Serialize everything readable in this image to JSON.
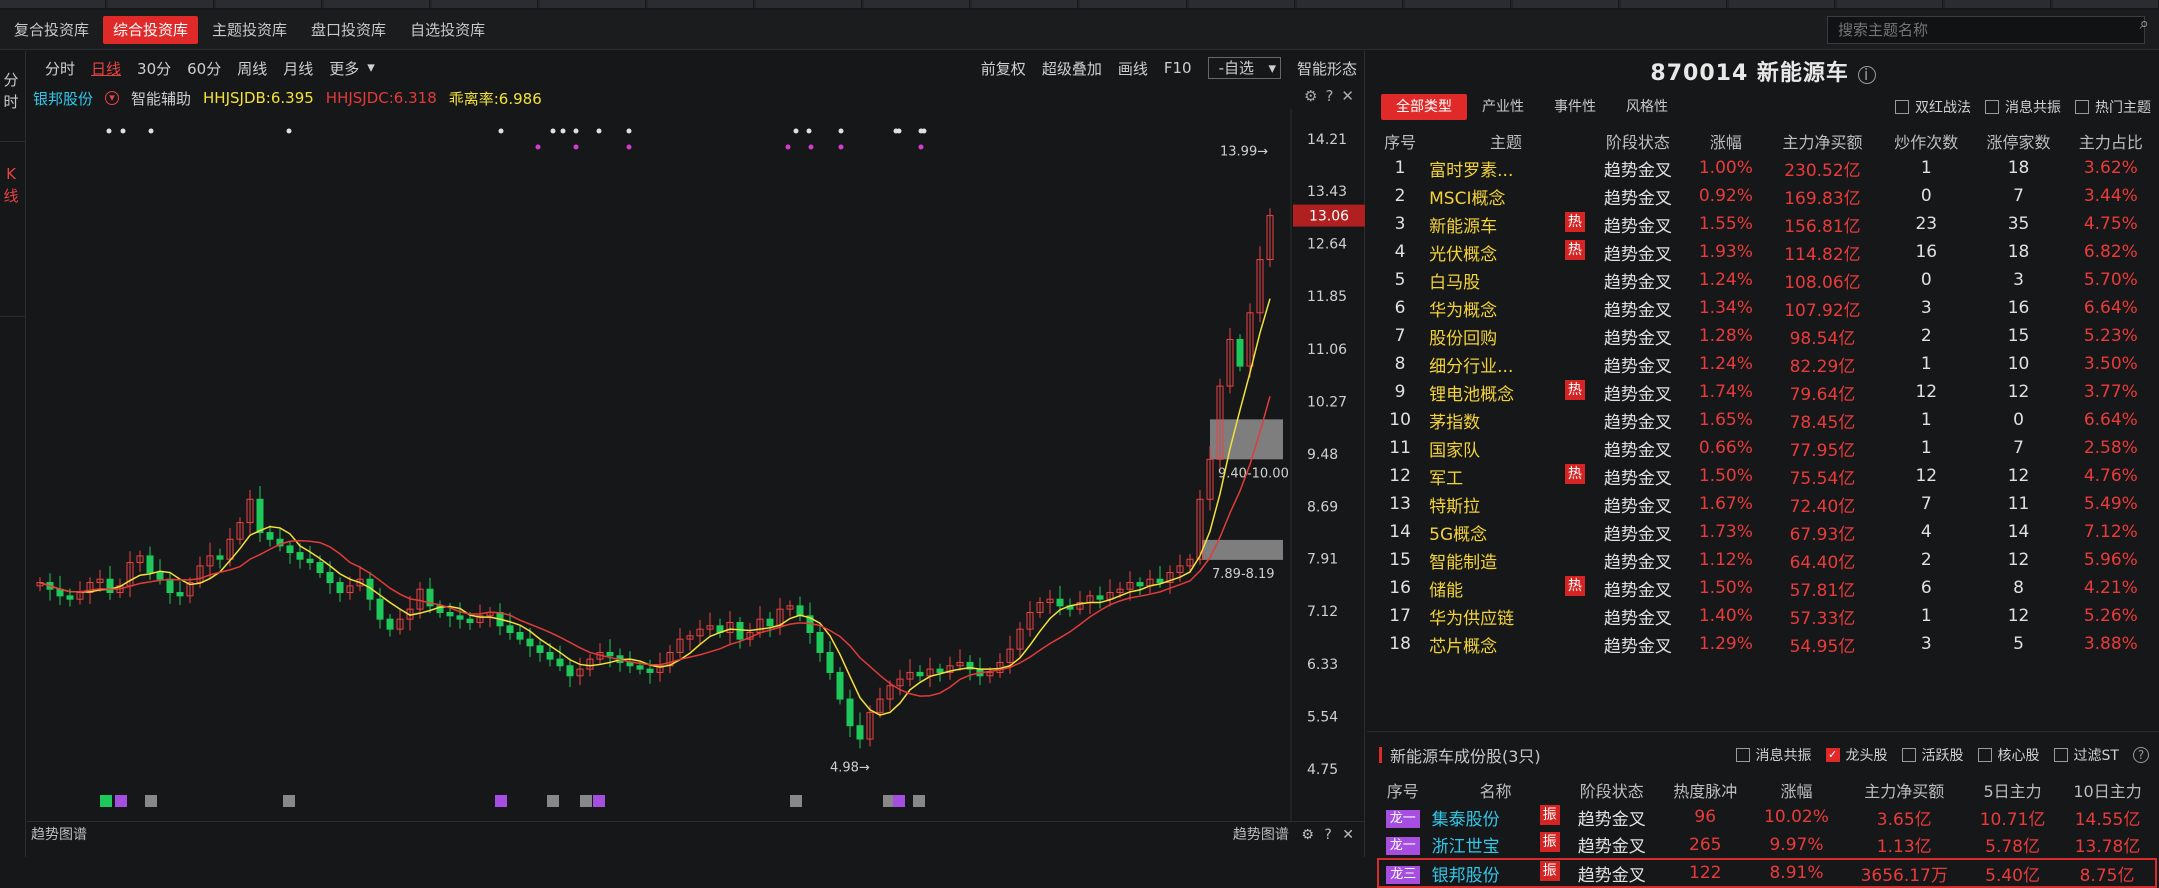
{
  "subnav": {
    "tabs": [
      "复合投资库",
      "综合投资库",
      "主题投资库",
      "盘口投资库",
      "自选投资库"
    ],
    "active_index": 1,
    "search_placeholder": "搜索主题名称"
  },
  "left_rail": {
    "tab_fenshi": "分时",
    "tab_kline": "K线"
  },
  "chart_toolbar": {
    "periods": [
      "分时",
      "日线",
      "30分",
      "60分",
      "周线",
      "月线",
      "更多"
    ],
    "active_period": 1,
    "right_items": [
      "前复权",
      "超级叠加",
      "画线",
      "F10",
      "智能形态"
    ],
    "zixuan_label": "-自选"
  },
  "indicator_bar": {
    "stock": "银邦股份",
    "assist": "智能辅助",
    "db": "HHJSJDB:6.395",
    "dc": "HHJSJDC:6.318",
    "ratio": "乖离率:6.986"
  },
  "chart_data": {
    "type": "candlestick",
    "y_ticks": [
      "14.21",
      "13.43",
      "12.64",
      "11.85",
      "11.06",
      "10.27",
      "9.48",
      "8.69",
      "7.91",
      "7.12",
      "6.33",
      "5.54",
      "4.75"
    ],
    "ylim": [
      4.75,
      14.21
    ],
    "current_price": "13.06",
    "high_label": "13.99",
    "low_label": "4.98",
    "zone_upper_label": "9.40-10.00",
    "zone_lower_label": "7.89-8.19",
    "zone_upper": [
      9.4,
      10.0
    ],
    "zone_lower": [
      7.89,
      8.19
    ],
    "closes": [
      7.55,
      7.45,
      7.35,
      7.3,
      7.4,
      7.55,
      7.6,
      7.4,
      7.5,
      7.85,
      7.95,
      7.7,
      7.6,
      7.4,
      7.35,
      7.55,
      7.8,
      7.95,
      7.9,
      8.2,
      8.45,
      8.8,
      8.3,
      8.2,
      8.1,
      8.0,
      7.9,
      7.85,
      7.7,
      7.55,
      7.4,
      7.5,
      7.6,
      7.3,
      7.0,
      6.85,
      7.0,
      7.15,
      7.45,
      7.2,
      7.1,
      7.05,
      7.0,
      6.95,
      7.05,
      7.1,
      6.9,
      6.8,
      6.7,
      6.6,
      6.5,
      6.4,
      6.3,
      6.15,
      6.25,
      6.4,
      6.5,
      6.45,
      6.35,
      6.3,
      6.25,
      6.2,
      6.3,
      6.5,
      6.7,
      6.75,
      6.85,
      6.9,
      6.8,
      6.95,
      6.7,
      6.8,
      7.0,
      6.9,
      7.15,
      7.2,
      7.05,
      6.8,
      6.5,
      6.2,
      5.8,
      5.4,
      5.2,
      5.6,
      5.8,
      6.0,
      6.1,
      6.2,
      6.15,
      6.25,
      6.2,
      6.3,
      6.35,
      6.25,
      6.15,
      6.2,
      6.35,
      6.55,
      6.85,
      7.1,
      7.25,
      7.3,
      7.2,
      7.15,
      7.25,
      7.35,
      7.3,
      7.4,
      7.45,
      7.55,
      7.5,
      7.6,
      7.55,
      7.7,
      7.8,
      7.9,
      8.8,
      9.4,
      10.5,
      11.2,
      10.8,
      11.6,
      12.4,
      13.06
    ]
  },
  "markers": {
    "top_white_dots": 12,
    "bottom_tags": [
      "减",
      "量",
      "日",
      "日",
      "量",
      "量",
      "日",
      "日",
      "量",
      "量",
      "減",
      "量"
    ]
  },
  "trend_panel": {
    "label": "趋势图谱",
    "right_label": "趋势图谱"
  },
  "right": {
    "title": "870014 新能源车",
    "filter_tabs": [
      "全部类型",
      "产业性",
      "事件性",
      "风格性"
    ],
    "active_filter": 0,
    "checks": [
      "双红战法",
      "消息共振",
      "热门主题"
    ],
    "table_headers": [
      "序号",
      "主题",
      "阶段状态",
      "涨幅",
      "主力净买额",
      "炒作次数",
      "涨停家数",
      "主力占比"
    ],
    "rows": [
      {
        "idx": "1",
        "name": "富时罗素...",
        "hot": "",
        "stage": "趋势金叉",
        "pct": "1.00%",
        "net": "230.52亿",
        "times": "1",
        "limit": "18",
        "ratio": "3.62%"
      },
      {
        "idx": "2",
        "name": "MSCI概念",
        "hot": "",
        "stage": "趋势金叉",
        "pct": "0.92%",
        "net": "169.83亿",
        "times": "0",
        "limit": "7",
        "ratio": "3.44%"
      },
      {
        "idx": "3",
        "name": "新能源车",
        "hot": "热",
        "stage": "趋势金叉",
        "pct": "1.55%",
        "net": "156.81亿",
        "times": "23",
        "limit": "35",
        "ratio": "4.75%"
      },
      {
        "idx": "4",
        "name": "光伏概念",
        "hot": "热",
        "stage": "趋势金叉",
        "pct": "1.93%",
        "net": "114.82亿",
        "times": "16",
        "limit": "18",
        "ratio": "6.82%"
      },
      {
        "idx": "5",
        "name": "白马股",
        "hot": "",
        "stage": "趋势金叉",
        "pct": "1.24%",
        "net": "108.06亿",
        "times": "0",
        "limit": "3",
        "ratio": "5.70%"
      },
      {
        "idx": "6",
        "name": "华为概念",
        "hot": "",
        "stage": "趋势金叉",
        "pct": "1.34%",
        "net": "107.92亿",
        "times": "3",
        "limit": "16",
        "ratio": "6.64%"
      },
      {
        "idx": "7",
        "name": "股份回购",
        "hot": "",
        "stage": "趋势金叉",
        "pct": "1.28%",
        "net": "98.54亿",
        "times": "2",
        "limit": "15",
        "ratio": "5.23%"
      },
      {
        "idx": "8",
        "name": "细分行业...",
        "hot": "",
        "stage": "趋势金叉",
        "pct": "1.24%",
        "net": "82.29亿",
        "times": "1",
        "limit": "10",
        "ratio": "3.50%"
      },
      {
        "idx": "9",
        "name": "锂电池概念",
        "hot": "热",
        "stage": "趋势金叉",
        "pct": "1.74%",
        "net": "79.64亿",
        "times": "12",
        "limit": "12",
        "ratio": "3.77%"
      },
      {
        "idx": "10",
        "name": "茅指数",
        "hot": "",
        "stage": "趋势金叉",
        "pct": "1.65%",
        "net": "78.45亿",
        "times": "1",
        "limit": "0",
        "ratio": "6.64%"
      },
      {
        "idx": "11",
        "name": "国家队",
        "hot": "",
        "stage": "趋势金叉",
        "pct": "0.66%",
        "net": "77.95亿",
        "times": "1",
        "limit": "7",
        "ratio": "2.58%"
      },
      {
        "idx": "12",
        "name": "军工",
        "hot": "热",
        "stage": "趋势金叉",
        "pct": "1.50%",
        "net": "75.54亿",
        "times": "12",
        "limit": "12",
        "ratio": "4.76%"
      },
      {
        "idx": "13",
        "name": "特斯拉",
        "hot": "",
        "stage": "趋势金叉",
        "pct": "1.67%",
        "net": "72.40亿",
        "times": "7",
        "limit": "11",
        "ratio": "5.49%"
      },
      {
        "idx": "14",
        "name": "5G概念",
        "hot": "",
        "stage": "趋势金叉",
        "pct": "1.73%",
        "net": "67.93亿",
        "times": "4",
        "limit": "14",
        "ratio": "7.12%"
      },
      {
        "idx": "15",
        "name": "智能制造",
        "hot": "",
        "stage": "趋势金叉",
        "pct": "1.12%",
        "net": "64.40亿",
        "times": "2",
        "limit": "12",
        "ratio": "5.96%"
      },
      {
        "idx": "16",
        "name": "储能",
        "hot": "热",
        "stage": "趋势金叉",
        "pct": "1.50%",
        "net": "57.81亿",
        "times": "6",
        "limit": "8",
        "ratio": "4.21%"
      },
      {
        "idx": "17",
        "name": "华为供应链",
        "hot": "",
        "stage": "趋势金叉",
        "pct": "1.40%",
        "net": "57.33亿",
        "times": "1",
        "limit": "12",
        "ratio": "5.26%"
      },
      {
        "idx": "18",
        "name": "芯片概念",
        "hot": "",
        "stage": "趋势金叉",
        "pct": "1.29%",
        "net": "54.95亿",
        "times": "3",
        "limit": "5",
        "ratio": "3.88%"
      }
    ],
    "components_title": "新能源车成份股(3只)",
    "comp_checks": [
      {
        "label": "消息共振",
        "checked": false
      },
      {
        "label": "龙头股",
        "checked": true
      },
      {
        "label": "活跃股",
        "checked": false
      },
      {
        "label": "核心股",
        "checked": false
      },
      {
        "label": "过滤ST",
        "checked": false
      }
    ],
    "comp_headers": [
      "序号",
      "名称",
      "阶段状态",
      "热度脉冲",
      "涨幅",
      "主力净买额",
      "5日主力",
      "10日主力"
    ],
    "comp_rows": [
      {
        "tag": "龙一",
        "name": "集泰股份",
        "zhen": "振",
        "stage": "趋势金叉",
        "heat": "96",
        "pct": "10.02%",
        "net": "3.65亿",
        "d5": "10.71亿",
        "d10": "14.55亿"
      },
      {
        "tag": "龙一",
        "name": "浙江世宝",
        "zhen": "振",
        "stage": "趋势金叉",
        "heat": "265",
        "pct": "9.97%",
        "net": "1.13亿",
        "d5": "5.78亿",
        "d10": "13.78亿"
      },
      {
        "tag": "龙三",
        "name": "银邦股份",
        "zhen": "振",
        "stage": "趋势金叉",
        "heat": "122",
        "pct": "8.91%",
        "net": "3656.17万",
        "d5": "5.40亿",
        "d10": "8.75亿"
      }
    ],
    "selected_comp": 2
  },
  "colors": {
    "up": "#e84343",
    "down": "#1ec85a",
    "ma_yellow": "#f2e23a",
    "ma_red": "#e23b3b",
    "accent": "#e02a2a",
    "selected_outline": "#d62c2c"
  }
}
